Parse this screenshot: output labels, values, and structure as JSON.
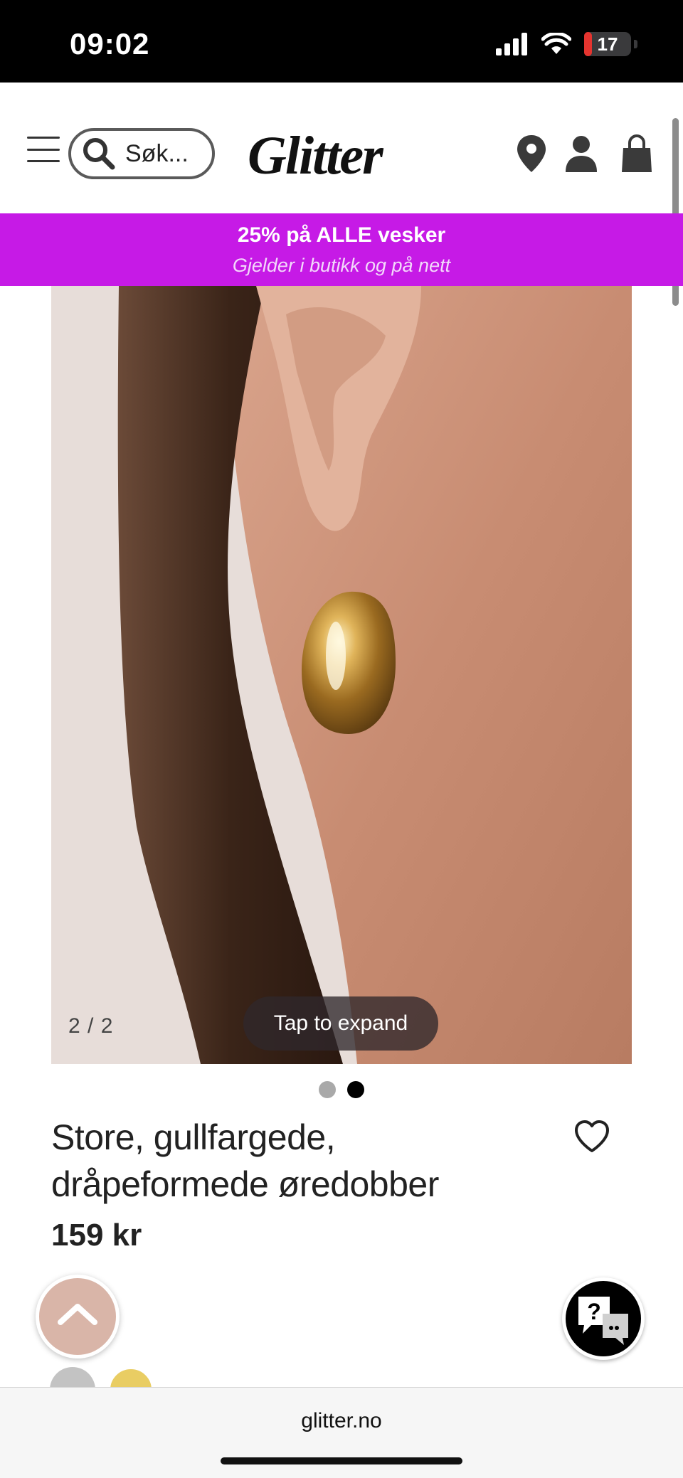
{
  "status_bar": {
    "time": "09:02",
    "battery": "17",
    "battery_level": 0.17,
    "icons": [
      "signal-icon",
      "wifi-icon",
      "battery-icon"
    ]
  },
  "header": {
    "search_placeholder": "Søk...",
    "logo": "Glitter",
    "icons": [
      "menu-icon",
      "search-icon",
      "location-icon",
      "account-icon",
      "cart-icon"
    ]
  },
  "promo": {
    "title": "25% på ALLE vesker",
    "subtitle": "Gjelder i butikk og på nett",
    "color": "#c61ae6"
  },
  "gallery": {
    "counter": "2 / 2",
    "expand_label": "Tap to expand",
    "current_index": 2,
    "total": 2
  },
  "product": {
    "title": "Store, gullfargede, dråpeformede øredobber",
    "price": "159 kr",
    "swatches": [
      "#c3c3c3",
      "#e9cd63"
    ]
  },
  "floating": {
    "back_to_top_color": "#d9b5a8",
    "help_icon": "help-chat-icon",
    "help_glyph": "?"
  },
  "browser": {
    "url": "glitter.no"
  }
}
